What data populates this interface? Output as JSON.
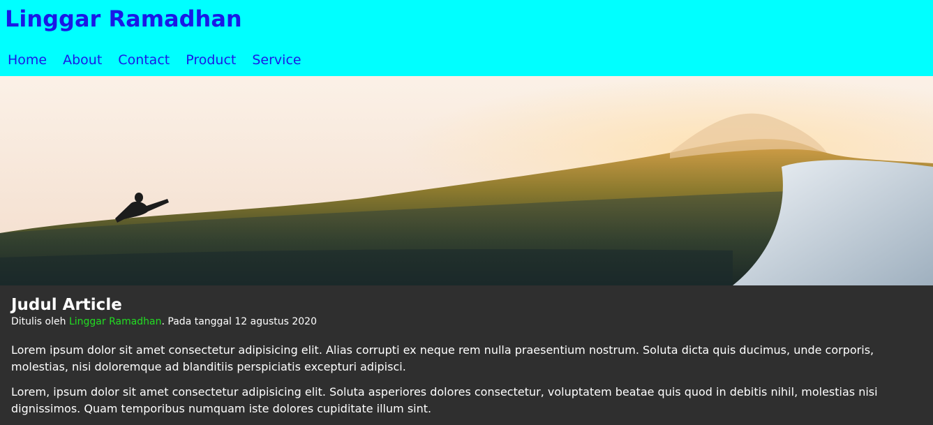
{
  "header": {
    "title": "Linggar Ramadhan",
    "nav": [
      "Home",
      "About",
      "Contact",
      "Product",
      "Service"
    ]
  },
  "hero": {
    "icon": "surf-wave-image"
  },
  "article": {
    "title": "Judul Article",
    "byline_prefix": "Ditulis oleh ",
    "author": "Linggar Ramadhan",
    "byline_suffix": ". Pada tanggal 12 agustus 2020",
    "paragraphs": [
      "Lorem ipsum dolor sit amet consectetur adipisicing elit. Alias corrupti ex neque rem nulla praesentium nostrum. Soluta dicta quis ducimus, unde corporis, molestias, nisi doloremque ad blanditiis perspiciatis excepturi adipisci.",
      "Lorem, ipsum dolor sit amet consectetur adipisicing elit. Soluta asperiores dolores consectetur, voluptatem beatae quis quod in debitis nihil, molestias nisi dignissimos. Quam temporibus numquam iste dolores cupiditate illum sint."
    ]
  },
  "colors": {
    "header_bg": "#00ffff",
    "title_color": "#1a18e6",
    "body_bg": "#2f2f2f",
    "author_color": "#22dd22"
  }
}
